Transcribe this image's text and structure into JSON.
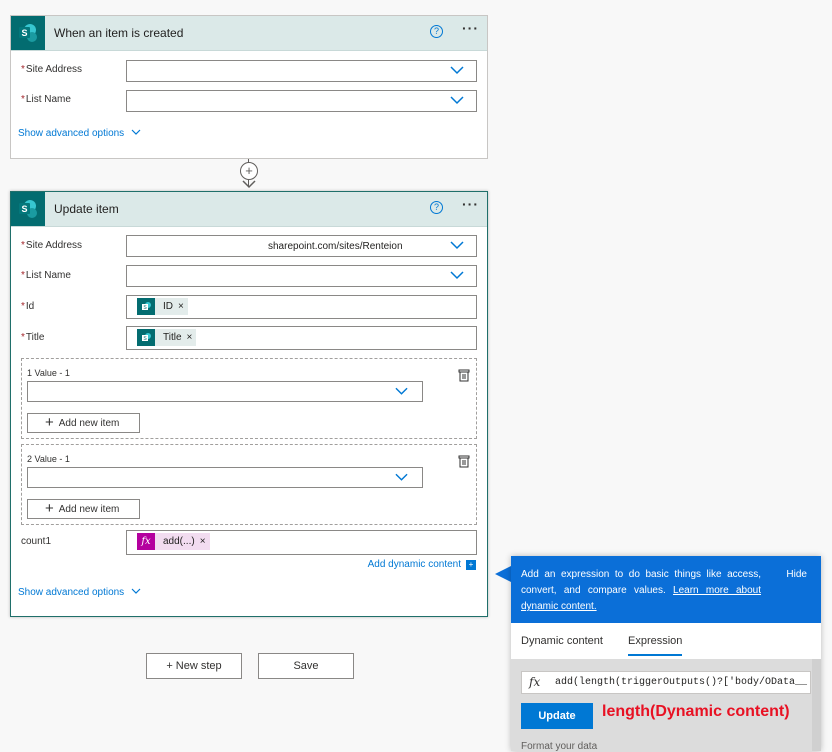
{
  "trigger_card": {
    "title": "When an item is created",
    "help": "?",
    "more": "···",
    "fields": [
      {
        "label": "Site Address",
        "required": "*"
      },
      {
        "label": "List Name",
        "required": "*"
      }
    ],
    "advanced": "Show advanced options"
  },
  "connector": {
    "plus": "+"
  },
  "action_card": {
    "title": "Update item",
    "help": "?",
    "more": "···",
    "site_address_label": "Site Address",
    "site_address_value": "sharepoint.com/sites/Renteion",
    "list_name_label": "List Name",
    "id_label": "Id",
    "id_token": "ID",
    "title_label": "Title",
    "title_token": "Title",
    "required": "*",
    "value1_label": "1 Value - 1",
    "value2_label": "2 Value - 1",
    "add_new_item": "Add new item",
    "count_label": "count1",
    "count_token": "add(...)",
    "token_x": "×",
    "add_dynamic": "Add dynamic content",
    "advanced": "Show advanced options"
  },
  "footer": {
    "new_step": "+ New step",
    "save": "Save"
  },
  "panel": {
    "description": "Add an expression to do basic things like access, convert, and compare values.",
    "learn_more": "Learn more about dynamic content.",
    "hide": "Hide",
    "tab_dynamic": "Dynamic content",
    "tab_expression": "Expression",
    "fx": "fx",
    "expression": "add(length(triggerOutputs()?['body/OData__",
    "update": "Update",
    "annotation": "length(Dynamic content)",
    "format": "Format your data"
  },
  "colors": {
    "sharepoint": "#036c70",
    "accent": "#0078d4",
    "expression_token": "#b4009e",
    "annotation": "#e81123"
  }
}
